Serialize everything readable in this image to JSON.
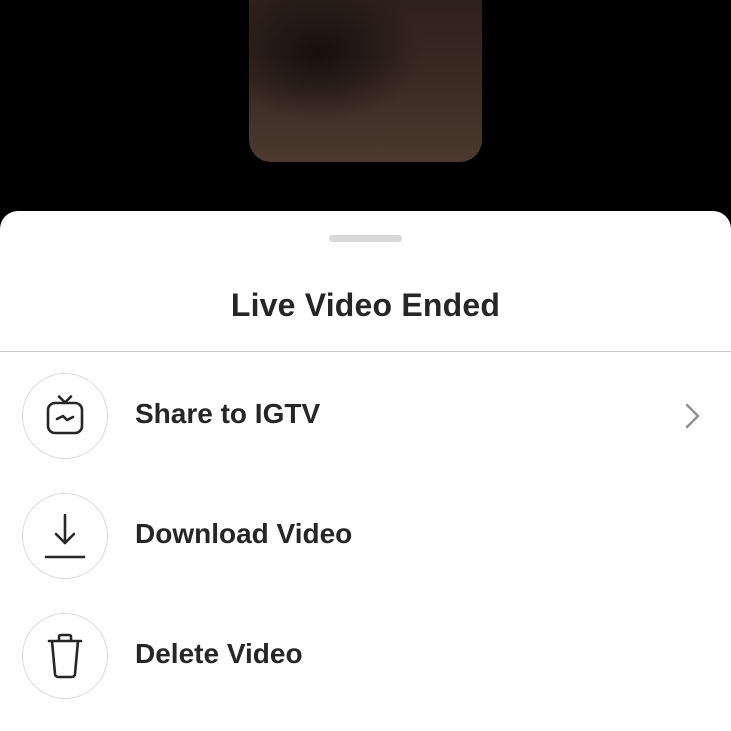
{
  "sheet": {
    "title": "Live Video Ended"
  },
  "options": [
    {
      "label": "Share to IGTV",
      "icon": "igtv-icon",
      "has_chevron": true
    },
    {
      "label": "Download Video",
      "icon": "download-icon",
      "has_chevron": false
    },
    {
      "label": "Delete Video",
      "icon": "trash-icon",
      "has_chevron": false
    }
  ]
}
